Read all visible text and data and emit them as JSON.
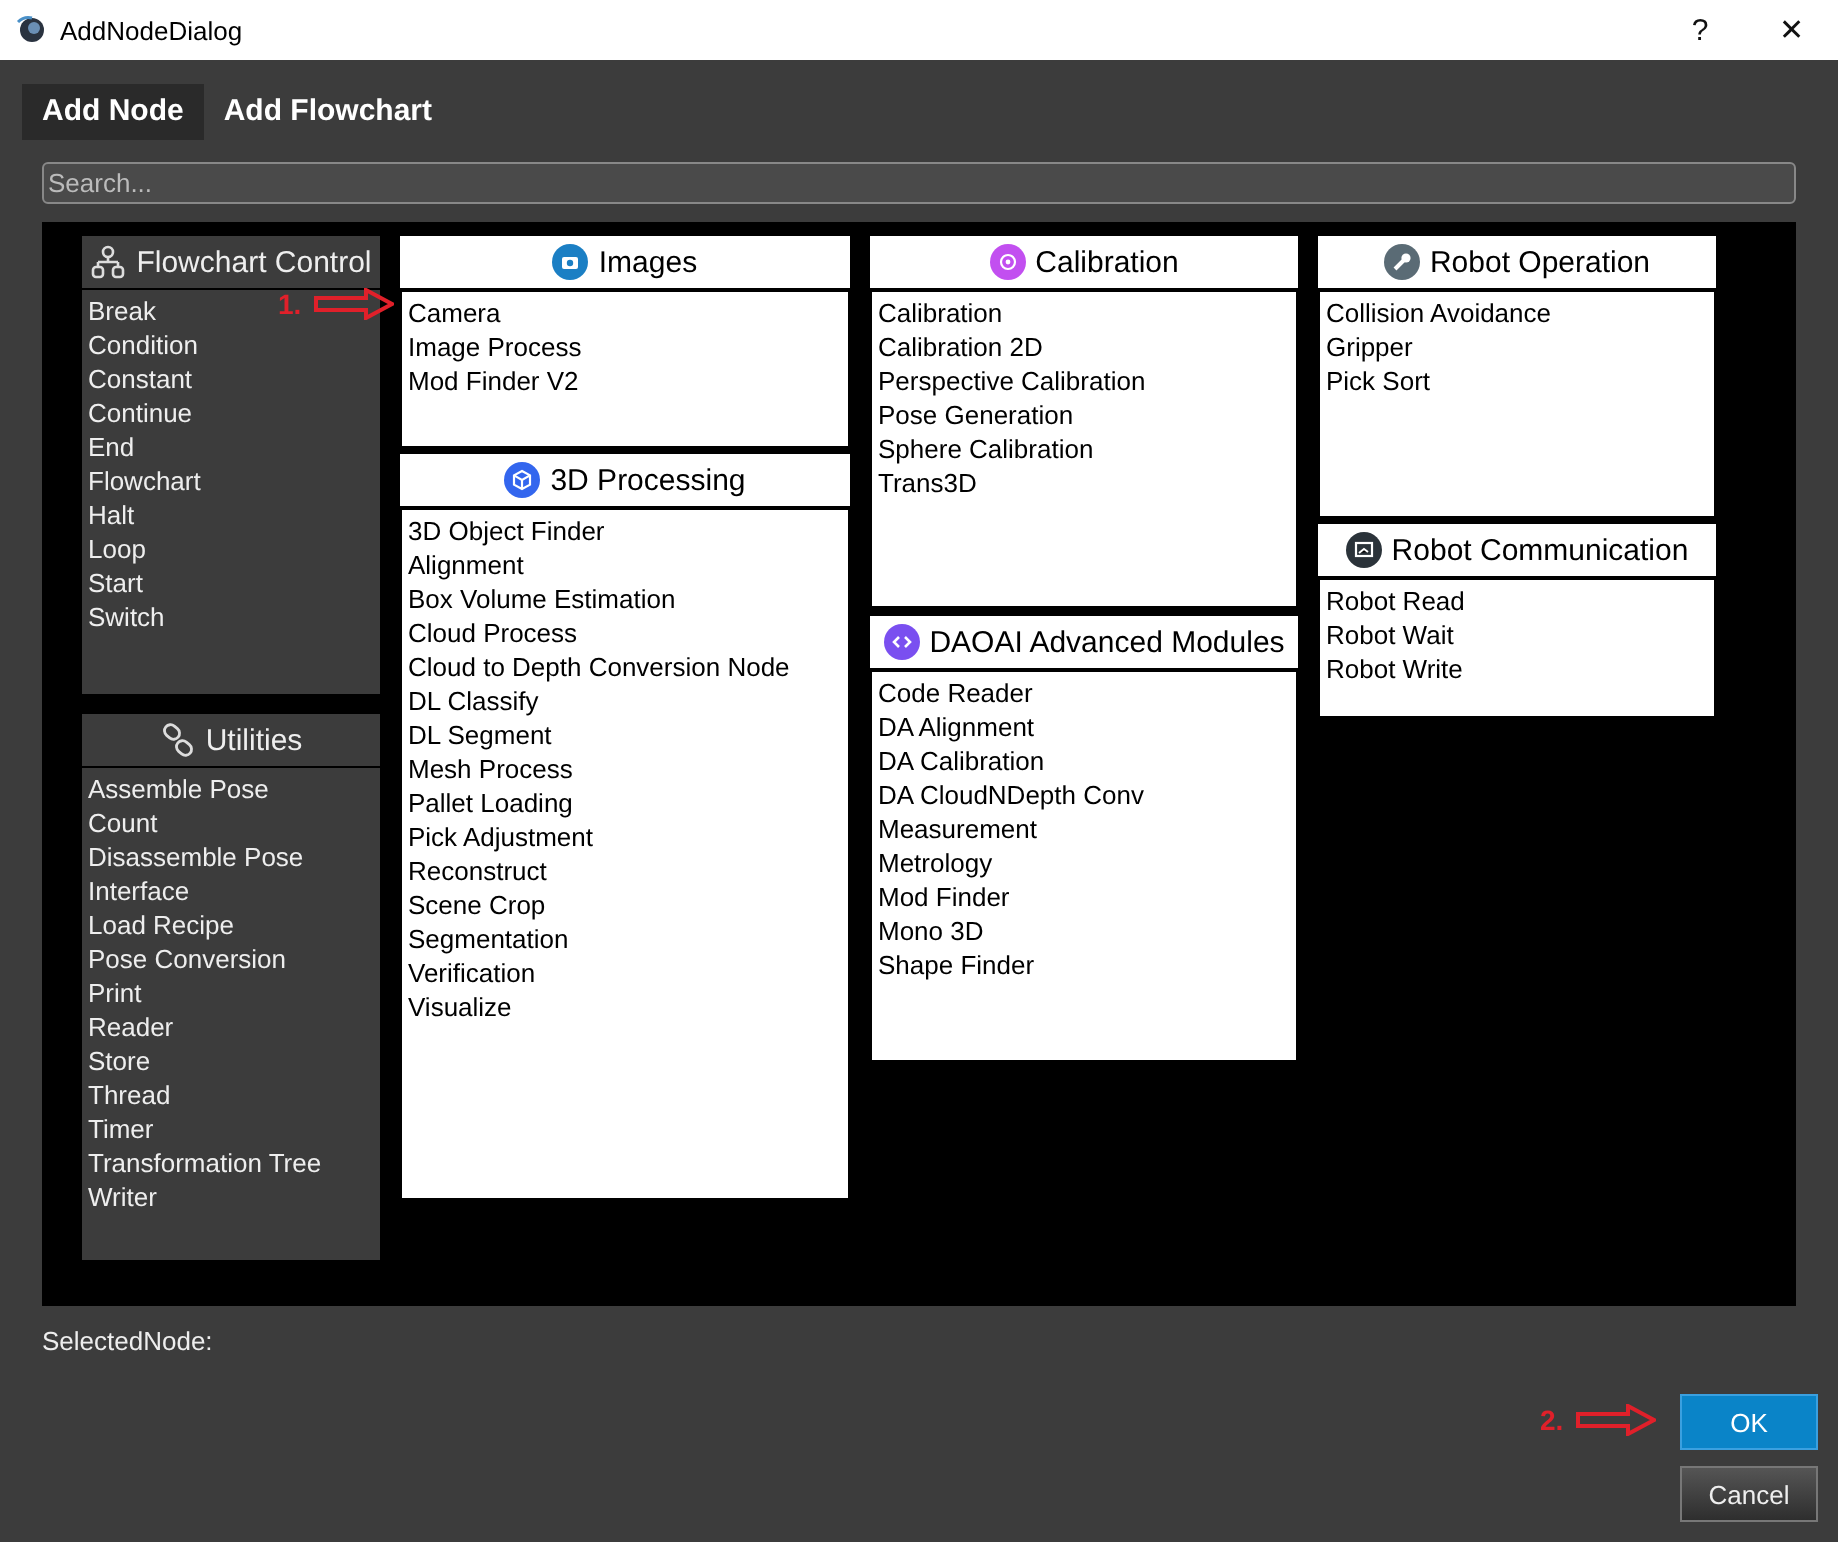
{
  "window": {
    "title": "AddNodeDialog",
    "controls": [
      "?",
      "✕"
    ]
  },
  "tabs": [
    {
      "label": "Add Node",
      "selected": true
    },
    {
      "label": "Add Flowchart",
      "selected": false
    }
  ],
  "search": {
    "placeholder": "Search..."
  },
  "columns": [
    [
      {
        "title": "Flowchart Control",
        "kind": "dark",
        "items": [
          "Break",
          "Condition",
          "Constant",
          "Continue",
          "End",
          "Flowchart",
          "Halt",
          "Loop",
          "Start",
          "Switch"
        ]
      },
      {
        "title": "Utilities",
        "kind": "dark",
        "items": [
          "Assemble Pose",
          "Count",
          "Disassemble Pose",
          "Interface",
          "Load Recipe",
          "Pose Conversion",
          "Print",
          "Reader",
          "Store",
          "Thread",
          "Timer",
          "Transformation Tree",
          "Writer"
        ]
      }
    ],
    [
      {
        "title": "Images",
        "kind": "light",
        "items": [
          "Camera",
          "Image Process",
          "Mod Finder V2"
        ]
      },
      {
        "title": "3D Processing",
        "kind": "light",
        "items": [
          "3D Object Finder",
          "Alignment",
          "Box Volume Estimation",
          "Cloud Process",
          "Cloud to Depth Conversion Node",
          "DL Classify",
          "DL Segment",
          "Mesh Process",
          "Pallet Loading",
          "Pick Adjustment",
          "Reconstruct",
          "Scene Crop",
          "Segmentation",
          "Verification",
          "Visualize"
        ]
      }
    ],
    [
      {
        "title": "Calibration",
        "kind": "light",
        "items": [
          "Calibration",
          "Calibration 2D",
          "Perspective Calibration",
          "Pose Generation",
          "Sphere Calibration",
          "Trans3D"
        ]
      },
      {
        "title": "DAOAI Advanced Modules",
        "kind": "light",
        "items": [
          "Code Reader",
          "DA Alignment",
          "DA Calibration",
          "DA CloudNDepth Conv",
          "Measurement",
          "Metrology",
          "Mod Finder",
          "Mono 3D",
          "Shape Finder"
        ]
      }
    ],
    [
      {
        "title": "Robot Operation",
        "kind": "light",
        "items": [
          "Collision Avoidance",
          "Gripper",
          "Pick Sort"
        ]
      },
      {
        "title": "Robot Communication",
        "kind": "light",
        "items": [
          "Robot Read",
          "Robot Wait",
          "Robot Write"
        ]
      }
    ]
  ],
  "selected_node": {
    "label": "SelectedNode:"
  },
  "buttons": [
    {
      "label": "OK",
      "kind": "primary"
    },
    {
      "label": "Cancel",
      "kind": "secondary"
    }
  ],
  "annotations": [
    {
      "label": "1."
    },
    {
      "label": "2."
    }
  ]
}
